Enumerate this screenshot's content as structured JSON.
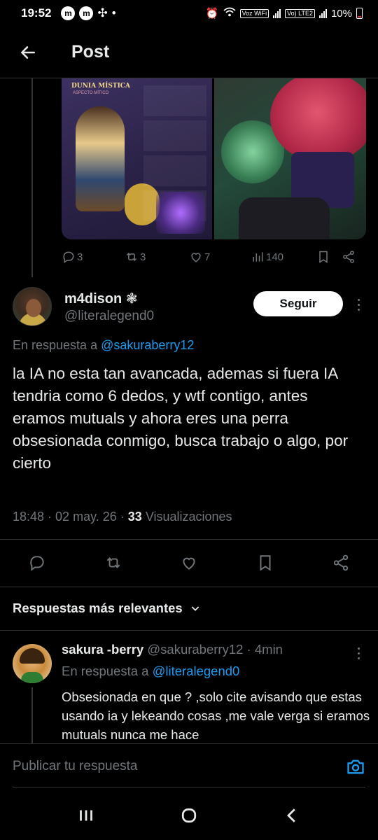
{
  "status_bar": {
    "time": "19:52",
    "notif_icons": [
      "m",
      "m"
    ],
    "voz_label": "Voz WiFi",
    "volte_label": "Vo) LTE2",
    "battery": "10%"
  },
  "header": {
    "title": "Post"
  },
  "media": {
    "image1_title": "DUNIA MÍSTICA",
    "image1_subtitle": "ASPECTO MÍTICO"
  },
  "parent_actions": {
    "replies": "3",
    "reposts": "3",
    "likes": "7",
    "views": "140"
  },
  "post": {
    "display_name": "m4dison",
    "name_badge": "❃",
    "handle": "@literalegend0",
    "follow_label": "Seguir",
    "reply_to_prefix": "En respuesta a",
    "reply_to_handle": "@sakuraberry12",
    "text": "la IA no esta tan avancada, ademas si fuera IA tendria como 6 dedos, y wtf contigo, antes eramos mutuals y ahora eres una perra obsesionada conmigo, busca trabajo o algo, por cierto",
    "time": "18:48",
    "date": "02 may. 26",
    "views_count": "33",
    "views_label": "Visualizaciones"
  },
  "replies_section": {
    "sort_label": "Respuestas más relevantes"
  },
  "reply": {
    "display_name": "sakura -berry",
    "handle": "@sakuraberry12",
    "age": "4min",
    "reply_to_prefix": "En respuesta a",
    "reply_to_handle": "@literalegend0",
    "text": "Obsesionada en que ? ,solo cite avisando que estas usando ia y lekeando cosas ,me vale verga si eramos mutuals nunca me hace"
  },
  "compose": {
    "placeholder": "Publicar tu respuesta"
  },
  "colors": {
    "accent": "#1d9bf0",
    "background": "#000000",
    "muted": "#71767b",
    "text": "#e7e9ea"
  }
}
